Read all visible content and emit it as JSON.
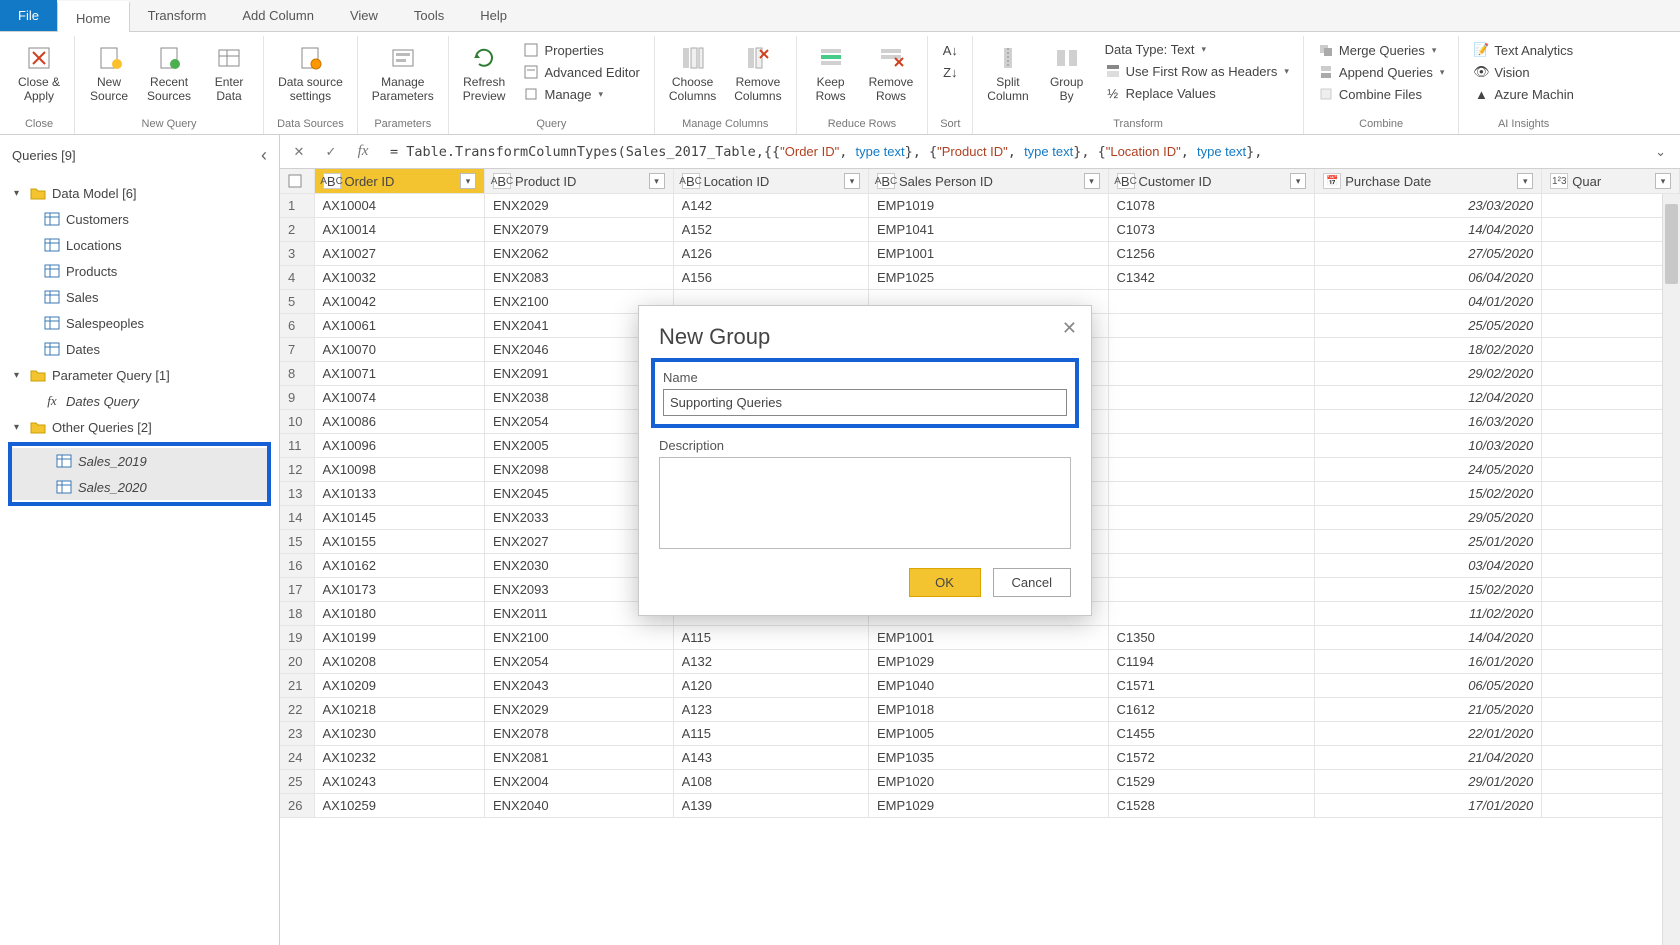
{
  "tabs": {
    "file": "File",
    "home": "Home",
    "transform": "Transform",
    "addcol": "Add Column",
    "view": "View",
    "tools": "Tools",
    "help": "Help"
  },
  "ribbon": {
    "close": {
      "label": "Close &\nApply",
      "group": "Close"
    },
    "new_query": {
      "new_source": "New\nSource",
      "recent": "Recent\nSources",
      "enter": "Enter\nData",
      "group": "New Query"
    },
    "data_sources": {
      "settings": "Data source\nsettings",
      "group": "Data Sources"
    },
    "parameters": {
      "manage": "Manage\nParameters",
      "group": "Parameters"
    },
    "query": {
      "refresh": "Refresh\nPreview",
      "properties": "Properties",
      "advanced": "Advanced Editor",
      "manage": "Manage",
      "group": "Query"
    },
    "manage_cols": {
      "choose": "Choose\nColumns",
      "remove": "Remove\nColumns",
      "group": "Manage Columns"
    },
    "reduce": {
      "keep": "Keep\nRows",
      "remove": "Remove\nRows",
      "group": "Reduce Rows"
    },
    "sort": {
      "group": "Sort"
    },
    "transform": {
      "split": "Split\nColumn",
      "groupby": "Group\nBy",
      "datatype": "Data Type: Text",
      "firstrow": "Use First Row as Headers",
      "replace": "Replace Values",
      "group": "Transform"
    },
    "combine": {
      "merge": "Merge Queries",
      "append": "Append Queries",
      "files": "Combine Files",
      "group": "Combine"
    },
    "ai": {
      "text": "Text Analytics",
      "vision": "Vision",
      "azure": "Azure Machin",
      "group": "AI Insights"
    }
  },
  "sidebar": {
    "title": "Queries [9]",
    "folders": [
      {
        "name": "Data Model [6]",
        "items": [
          "Customers",
          "Locations",
          "Products",
          "Sales",
          "Salespeoples",
          "Dates"
        ]
      },
      {
        "name": "Parameter Query [1]",
        "items_fx": [
          "Dates Query"
        ]
      },
      {
        "name": "Other Queries [2]",
        "highlight_items": [
          "Sales_2019",
          "Sales_2020"
        ]
      }
    ]
  },
  "formula": {
    "prefix": "= Table.TransformColumnTypes(Sales_2017_Table,{{",
    "pairs": [
      [
        "\"Order ID\"",
        "type text"
      ],
      [
        "\"Product ID\"",
        "type text"
      ],
      [
        "\"Location ID\"",
        "type text"
      ]
    ]
  },
  "columns": [
    {
      "name": "Order ID",
      "type": "ABC",
      "sel": true
    },
    {
      "name": "Product ID",
      "type": "ABC"
    },
    {
      "name": "Location ID",
      "type": "ABC"
    },
    {
      "name": "Sales Person ID",
      "type": "ABC"
    },
    {
      "name": "Customer ID",
      "type": "ABC"
    },
    {
      "name": "Purchase Date",
      "type": "date"
    },
    {
      "name": "Quar",
      "type": "123"
    }
  ],
  "rows": [
    [
      "AX10004",
      "ENX2029",
      "A142",
      "EMP1019",
      "C1078",
      "23/03/2020"
    ],
    [
      "AX10014",
      "ENX2079",
      "A152",
      "EMP1041",
      "C1073",
      "14/04/2020"
    ],
    [
      "AX10027",
      "ENX2062",
      "A126",
      "EMP1001",
      "C1256",
      "27/05/2020"
    ],
    [
      "AX10032",
      "ENX2083",
      "A156",
      "EMP1025",
      "C1342",
      "06/04/2020"
    ],
    [
      "AX10042",
      "ENX2100",
      "",
      "",
      "",
      "04/01/2020"
    ],
    [
      "AX10061",
      "ENX2041",
      "",
      "",
      "",
      "25/05/2020"
    ],
    [
      "AX10070",
      "ENX2046",
      "",
      "",
      "",
      "18/02/2020"
    ],
    [
      "AX10071",
      "ENX2091",
      "",
      "",
      "",
      "29/02/2020"
    ],
    [
      "AX10074",
      "ENX2038",
      "",
      "",
      "",
      "12/04/2020"
    ],
    [
      "AX10086",
      "ENX2054",
      "",
      "",
      "",
      "16/03/2020"
    ],
    [
      "AX10096",
      "ENX2005",
      "",
      "",
      "",
      "10/03/2020"
    ],
    [
      "AX10098",
      "ENX2098",
      "",
      "",
      "",
      "24/05/2020"
    ],
    [
      "AX10133",
      "ENX2045",
      "",
      "",
      "",
      "15/02/2020"
    ],
    [
      "AX10145",
      "ENX2033",
      "",
      "",
      "",
      "29/05/2020"
    ],
    [
      "AX10155",
      "ENX2027",
      "",
      "",
      "",
      "25/01/2020"
    ],
    [
      "AX10162",
      "ENX2030",
      "",
      "",
      "",
      "03/04/2020"
    ],
    [
      "AX10173",
      "ENX2093",
      "",
      "",
      "",
      "15/02/2020"
    ],
    [
      "AX10180",
      "ENX2011",
      "",
      "",
      "",
      "11/02/2020"
    ],
    [
      "AX10199",
      "ENX2100",
      "A115",
      "EMP1001",
      "C1350",
      "14/04/2020"
    ],
    [
      "AX10208",
      "ENX2054",
      "A132",
      "EMP1029",
      "C1194",
      "16/01/2020"
    ],
    [
      "AX10209",
      "ENX2043",
      "A120",
      "EMP1040",
      "C1571",
      "06/05/2020"
    ],
    [
      "AX10218",
      "ENX2029",
      "A123",
      "EMP1018",
      "C1612",
      "21/05/2020"
    ],
    [
      "AX10230",
      "ENX2078",
      "A115",
      "EMP1005",
      "C1455",
      "22/01/2020"
    ],
    [
      "AX10232",
      "ENX2081",
      "A143",
      "EMP1035",
      "C1572",
      "21/04/2020"
    ],
    [
      "AX10243",
      "ENX2004",
      "A108",
      "EMP1020",
      "C1529",
      "29/01/2020"
    ],
    [
      "AX10259",
      "ENX2040",
      "A139",
      "EMP1029",
      "C1528",
      "17/01/2020"
    ]
  ],
  "dialog": {
    "title": "New Group",
    "name_label": "Name",
    "name_value": "Supporting Queries",
    "desc_label": "Description",
    "ok": "OK",
    "cancel": "Cancel"
  }
}
